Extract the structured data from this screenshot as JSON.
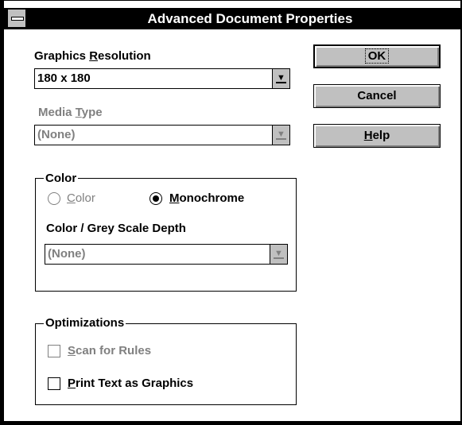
{
  "window": {
    "title": "Advanced Document Properties"
  },
  "graphics_resolution": {
    "label_pre": "Graphics ",
    "label_key": "R",
    "label_post": "esolution",
    "value": "180 x 180"
  },
  "media_type": {
    "label_pre": "Media ",
    "label_key": "T",
    "label_post": "ype",
    "value": "(None)",
    "enabled": false
  },
  "buttons": {
    "ok": "OK",
    "cancel": "Cancel",
    "help_key": "H",
    "help_post": "elp"
  },
  "color_group": {
    "title": "Color",
    "color_option": {
      "key": "C",
      "post": "olor",
      "selected": false,
      "enabled": false
    },
    "mono_option": {
      "key": "M",
      "post": "onochrome",
      "selected": true,
      "enabled": true
    },
    "depth_label": "Color / Grey Scale Depth",
    "depth_value": "(None)",
    "depth_enabled": false
  },
  "optimizations_group": {
    "title": "Optimizations",
    "scan_rules": {
      "key": "S",
      "post": "can for Rules",
      "checked": false,
      "enabled": false
    },
    "print_text": {
      "key": "P",
      "post": "rint Text as Graphics",
      "checked": false,
      "enabled": true
    }
  },
  "icons": {
    "system_menu": "system-menu-icon",
    "dropdown": "dropdown-arrow-icon"
  },
  "colors": {
    "title_bar": "#000000",
    "button_face": "#c0c0c0",
    "disabled_text": "#808080"
  }
}
